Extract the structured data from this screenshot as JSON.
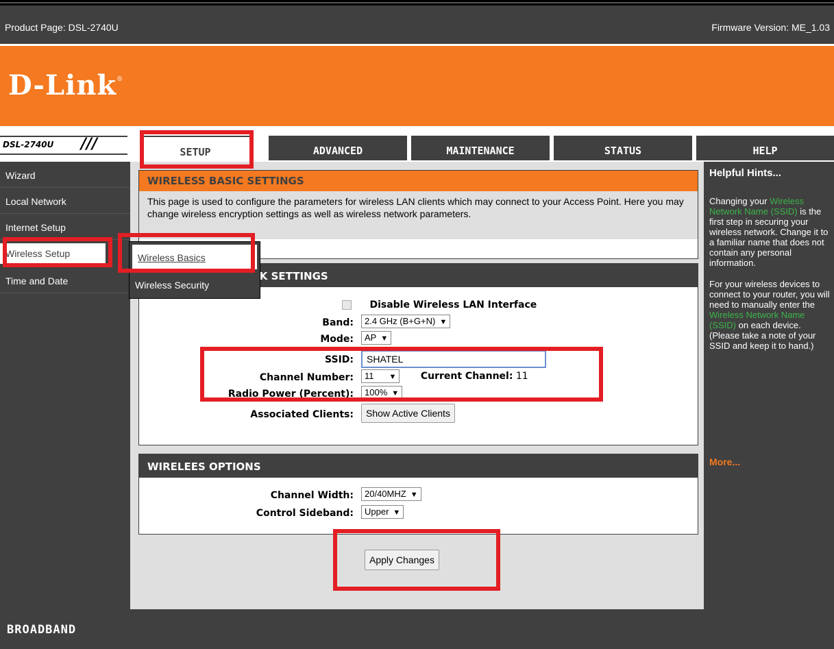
{
  "topbar": {
    "product": "Product Page: DSL-2740U",
    "firmware": "Firmware Version: ME_1.03"
  },
  "banner": {
    "logo": "D-Link",
    "reg": "®"
  },
  "nav": {
    "model": "DSL-2740U",
    "slashes": "///",
    "tabs": [
      {
        "label": "SETUP",
        "active": true
      },
      {
        "label": "ADVANCED"
      },
      {
        "label": "MAINTENANCE"
      },
      {
        "label": "STATUS"
      },
      {
        "label": "HELP"
      }
    ]
  },
  "sidebar": {
    "items": [
      {
        "label": "Wizard"
      },
      {
        "label": "Local Network"
      },
      {
        "label": "Internet Setup"
      },
      {
        "label": "Wireless Setup",
        "active": true
      },
      {
        "label": "Time and Date"
      }
    ],
    "submenu": [
      {
        "label": "Wireless Basics",
        "active": true
      },
      {
        "label": "Wireless Security"
      }
    ]
  },
  "basic": {
    "title": "WIRELESS BASIC SETTINGS",
    "intro": "This page is used to configure the parameters for wireless LAN clients which may connect to your Access Point. Here you may change wireless encryption settings as well as wireless network parameters."
  },
  "network": {
    "title": "WIRELESS NETWORK SETTINGS",
    "disable_label": "Disable Wireless LAN Interface",
    "band_label": "Band:",
    "band_value": "2.4 GHz (B+G+N)",
    "mode_label": "Mode:",
    "mode_value": "AP",
    "ssid_label": "SSID:",
    "ssid_value": "SHATEL",
    "channel_label": "Channel Number:",
    "channel_value": "11",
    "current_channel_label": "Current Channel:",
    "current_channel_value": "11",
    "power_label": "Radio Power (Percent):",
    "power_value": "100%",
    "clients_label": "Associated Clients:",
    "clients_button": "Show Active Clients"
  },
  "options": {
    "title": "WIRELEES OPTIONS",
    "width_label": "Channel Width:",
    "width_value": "20/40MHZ",
    "sideband_label": "Control Sideband:",
    "sideband_value": "Upper"
  },
  "apply_button": "Apply Changes",
  "hints": {
    "title": "Helpful Hints...",
    "p1_a": "Changing your ",
    "p1_b": "Wireless Network Name (SSID)",
    "p1_c": " is the first step in securing your wireless network. Change it to a familiar name that does not contain any personal information.",
    "p2_a": "For your wireless devices to connect to your router, you will need to manually enter the ",
    "p2_b": "Wireless Network Name (SSID)",
    "p2_c": " on each device. (Please take a note of your SSID and keep it to hand.)",
    "more": "More..."
  },
  "footer": {
    "brand": "BROADBAND"
  },
  "colors": {
    "orange": "#f47920",
    "dark": "#404040",
    "highlight_red": "#e31e24",
    "hint_green": "#3cb54a"
  }
}
